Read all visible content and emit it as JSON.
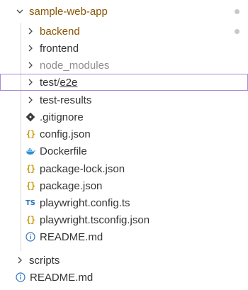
{
  "explorer": {
    "root": {
      "label": "sample-web-app",
      "modified_dot_color": "#c8c8c8"
    },
    "items": [
      {
        "label": "backend",
        "kind": "folder",
        "status": "modified",
        "dot_color": "#c8c8c8"
      },
      {
        "label": "frontend",
        "kind": "folder"
      },
      {
        "label": "node_modules",
        "kind": "folder",
        "status": "ignored"
      },
      {
        "label_parts": [
          "test",
          "/",
          "e2e"
        ],
        "kind": "folder",
        "selected": true
      },
      {
        "label": "test-results",
        "kind": "folder"
      },
      {
        "label": ".gitignore",
        "kind": "file",
        "icon": "git-diamond-icon"
      },
      {
        "label": "config.json",
        "kind": "file",
        "icon": "json-braces-icon"
      },
      {
        "label": "Dockerfile",
        "kind": "file",
        "icon": "docker-whale-icon"
      },
      {
        "label": "package-lock.json",
        "kind": "file",
        "icon": "json-braces-icon"
      },
      {
        "label": "package.json",
        "kind": "file",
        "icon": "json-braces-icon"
      },
      {
        "label": "playwright.config.ts",
        "kind": "file",
        "icon": "typescript-icon",
        "icon_text": "TS"
      },
      {
        "label": "playwright.tsconfig.json",
        "kind": "file",
        "icon": "json-braces-icon"
      },
      {
        "label": "README.md",
        "kind": "file",
        "icon": "info-circle-icon"
      }
    ],
    "siblings": [
      {
        "label": "scripts",
        "kind": "folder"
      },
      {
        "label": "README.md",
        "kind": "file",
        "icon": "info-circle-icon"
      }
    ],
    "json_icon_text": "{}",
    "colors": {
      "modified": "#895503",
      "ignored": "#8e8e8e",
      "selection_outline": "#a98bd8",
      "json_icon": "#c99b12",
      "ts_icon": "#2f74c0",
      "info_icon": "#2f74c0",
      "docker_icon": "#2a8fd6",
      "git_icon": "#3c3c3c"
    }
  }
}
